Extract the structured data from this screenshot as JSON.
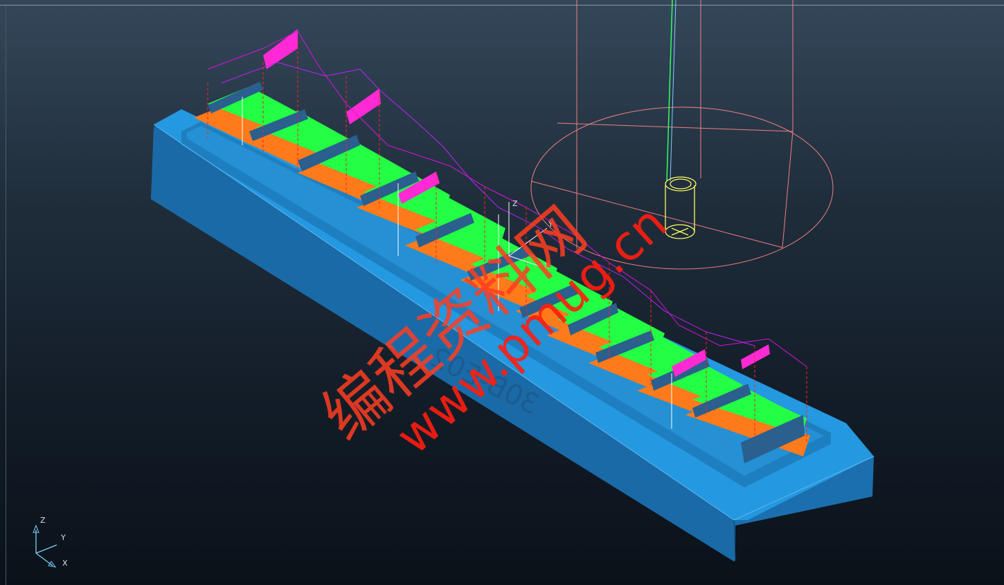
{
  "viewport": {
    "background_top": "#34475a",
    "background_bottom": "#0a1119"
  },
  "part": {
    "engraved_label": "30B-E02",
    "base_top_color": "#2196dc",
    "base_side_color": "#1b6fae",
    "toolpath_colors": [
      "#ff00ff",
      "#00ff33",
      "#ff7a1a",
      "#ff2020",
      "#ffffff"
    ]
  },
  "tool": {
    "holder_color": "#f08080",
    "cutter_color": "#ffff66",
    "spindle_color": "#33ff66"
  },
  "wcs_triad": {
    "x_label": "X",
    "y_label": "Y",
    "z_label": "Z"
  },
  "view_triad": {
    "x_label": "X",
    "y_label": "Y",
    "z_label": "Z"
  },
  "watermark": {
    "chinese": "编程资料网",
    "url": "www.pmug.cn"
  }
}
